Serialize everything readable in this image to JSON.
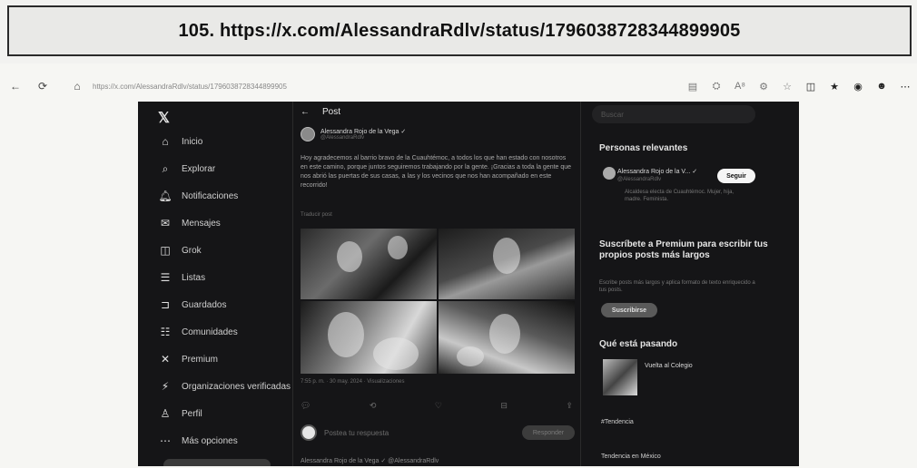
{
  "caption": {
    "title": "105. https://x.com/AlessandraRdlv/status/1796038728344899905"
  },
  "browser": {
    "url": "https://x.com/AlessandraRdlv/status/1796038728344899905",
    "icons": [
      "back-icon",
      "refresh-icon",
      "home-icon",
      "reader-icon",
      "translate-icon",
      "read-aloud-icon",
      "extensions-icon",
      "favorite-icon",
      "split-screen-icon",
      "favorites-bar-icon",
      "collections-icon",
      "profile-icon",
      "more-icon"
    ]
  },
  "sidebar": {
    "logo": "𝕏",
    "items": [
      {
        "icon": "home-icon",
        "glyph": "⌂",
        "label": "Inicio"
      },
      {
        "icon": "search-icon",
        "glyph": "⌕",
        "label": "Explorar"
      },
      {
        "icon": "bell-icon",
        "glyph": "🔔︎",
        "label": "Notificaciones"
      },
      {
        "icon": "mail-icon",
        "glyph": "✉",
        "label": "Mensajes"
      },
      {
        "icon": "grok-icon",
        "glyph": "◫",
        "label": "Grok"
      },
      {
        "icon": "list-icon",
        "glyph": "☰",
        "label": "Listas"
      },
      {
        "icon": "bookmark-icon",
        "glyph": "⊐",
        "label": "Guardados"
      },
      {
        "icon": "communities-icon",
        "glyph": "☷",
        "label": "Comunidades"
      },
      {
        "icon": "premium-icon",
        "glyph": "✕",
        "label": "Premium"
      },
      {
        "icon": "verified-org-icon",
        "glyph": "⚡︎",
        "label": "Organizaciones verificadas"
      },
      {
        "icon": "profile-icon",
        "glyph": "♙",
        "label": "Perfil"
      },
      {
        "icon": "more-options-icon",
        "glyph": "⋯",
        "label": "Más opciones"
      }
    ]
  },
  "feed": {
    "back_glyph": "←",
    "header": "Post",
    "author_name": "Alessandra Rojo de la Vega ✓",
    "author_handle": "@AlessandraRdlv",
    "text": "Hoy agradecemos al barrio bravo de la Cuauhtémoc, a todos los que han estado con nosotros en este camino, porque juntos seguiremos trabajando por la gente. ¡Gracias a toda la gente que nos abrió las puertas de sus casas, a las y los vecinos que nos han acompañado en este recorrido!",
    "translate": "Traducir post",
    "meta": "7:55 p. m. · 30 may. 2024 · Visualizaciones",
    "actions": [
      "💬︎",
      "⟲",
      "♡",
      "⊟",
      "⇪"
    ],
    "reply_placeholder": "Postea tu respuesta",
    "reply_button": "Responder",
    "next_post": "Alessandra Rojo de la Vega ✓ @AlessandraRdlv"
  },
  "right": {
    "search_placeholder": "Buscar",
    "relevant_title": "Personas relevantes",
    "relevant_name": "Alessandra Rojo de la V... ✓",
    "relevant_handle": "@AlessandraRdlv",
    "follow": "Seguir",
    "relevant_bio": "Alcaldesa electa de Cuauhtémoc. Mujer, hija, madre. Feminista.",
    "premium_title": "Suscríbete a Premium para escribir tus propios posts más largos",
    "premium_text": "Escribe posts más largos y aplica formato de texto enriquecido a tus posts.",
    "subscribe": "Suscribirse",
    "trends_title": "Qué está pasando",
    "trend1": "Vuelta al Colegio",
    "trend2": "#Tendencia",
    "trend3": "Tendencia en México"
  }
}
